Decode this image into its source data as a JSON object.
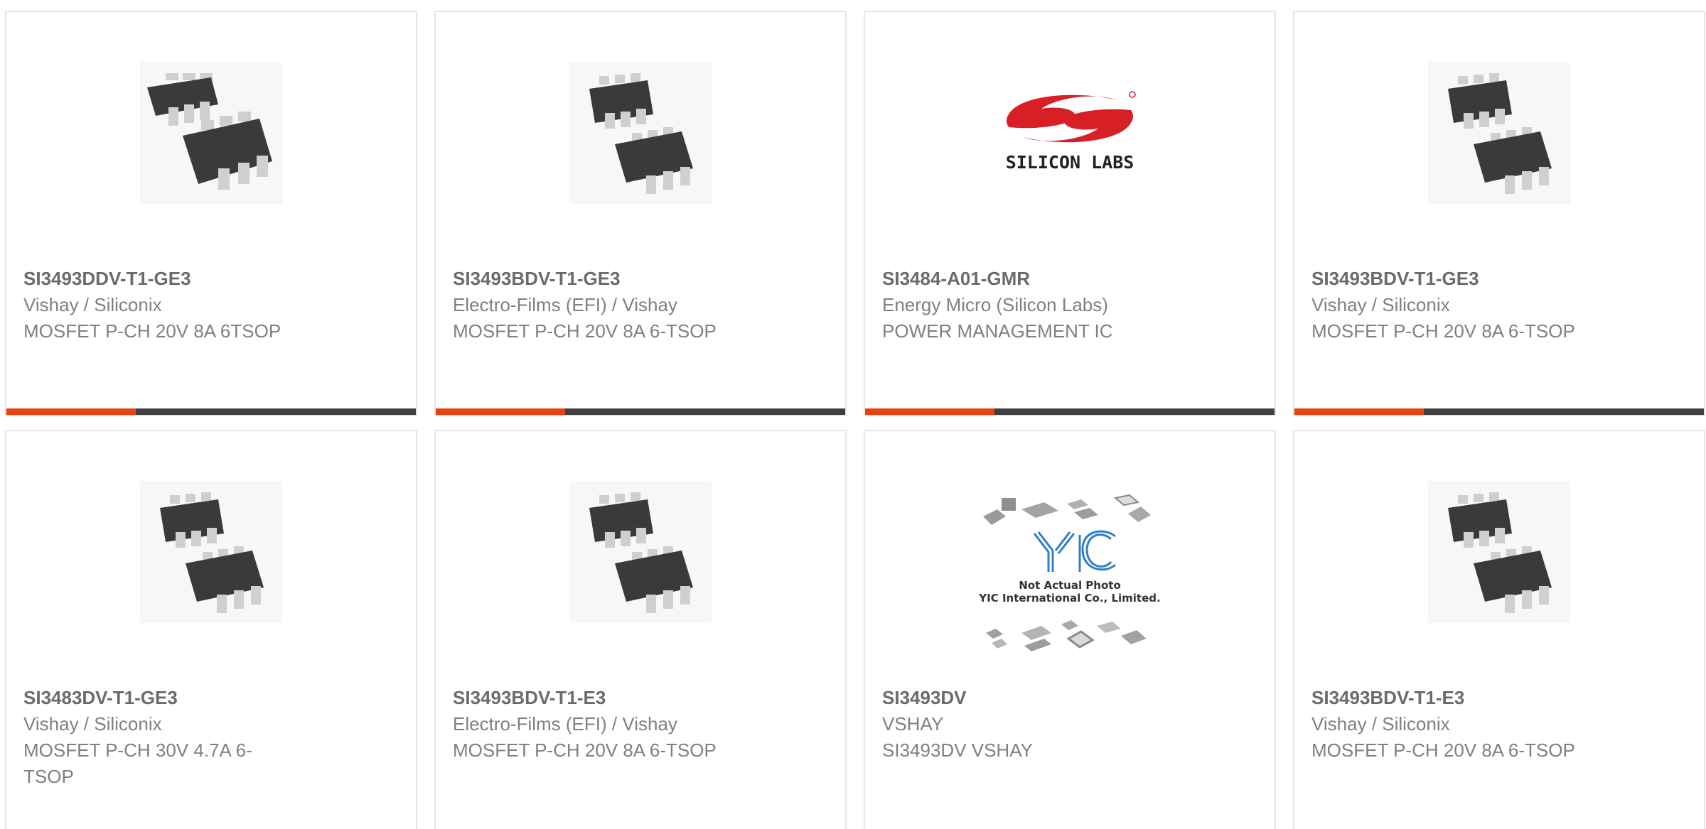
{
  "products": [
    {
      "part_number": "SI3493DDV-T1-GE3",
      "manufacturer": "Vishay / Siliconix",
      "description": "MOSFET P-CH 20V 8A 6TSOP",
      "image": "tsop6-package-icon"
    },
    {
      "part_number": "SI3493BDV-T1-GE3",
      "manufacturer": "Electro-Films (EFI) / Vishay",
      "description": "MOSFET P-CH 20V 8A 6-TSOP",
      "image": "tsop6-package-icon"
    },
    {
      "part_number": "SI3484-A01-GMR",
      "manufacturer": "Energy Micro (Silicon Labs)",
      "description": "POWER MANAGEMENT IC",
      "image": "silicon-labs-logo",
      "logo_text": "SILICON LABS"
    },
    {
      "part_number": "SI3493BDV-T1-GE3",
      "manufacturer": "Vishay / Siliconix",
      "description": "MOSFET P-CH 20V 8A 6-TSOP",
      "image": "tsop6-package-icon"
    },
    {
      "part_number": "SI3483DV-T1-GE3",
      "manufacturer": "Vishay / Siliconix",
      "description": "MOSFET P-CH 30V 4.7A 6-TSOP",
      "image": "tsop6-package-icon"
    },
    {
      "part_number": "SI3493BDV-T1-E3",
      "manufacturer": "Electro-Films (EFI) / Vishay",
      "description": "MOSFET P-CH 20V 8A 6-TSOP",
      "image": "tsop6-package-icon"
    },
    {
      "part_number": "SI3493DV",
      "manufacturer": "VSHAY",
      "description": "SI3493DV VSHAY",
      "image": "yic-placeholder-image",
      "logo_text": "YIC",
      "photo_note_1": "Not Actual Photo",
      "photo_note_2": "YIC International Co., Limited."
    },
    {
      "part_number": "SI3493BDV-T1-E3",
      "manufacturer": "Vishay / Siliconix",
      "description": "MOSFET P-CH 20V 8A 6-TSOP",
      "image": "tsop6-package-icon"
    }
  ],
  "colors": {
    "accent": "#e84210",
    "bar_dark": "#3f3f3f",
    "border": "#e6e6e6",
    "logo_red": "#d71f26"
  }
}
